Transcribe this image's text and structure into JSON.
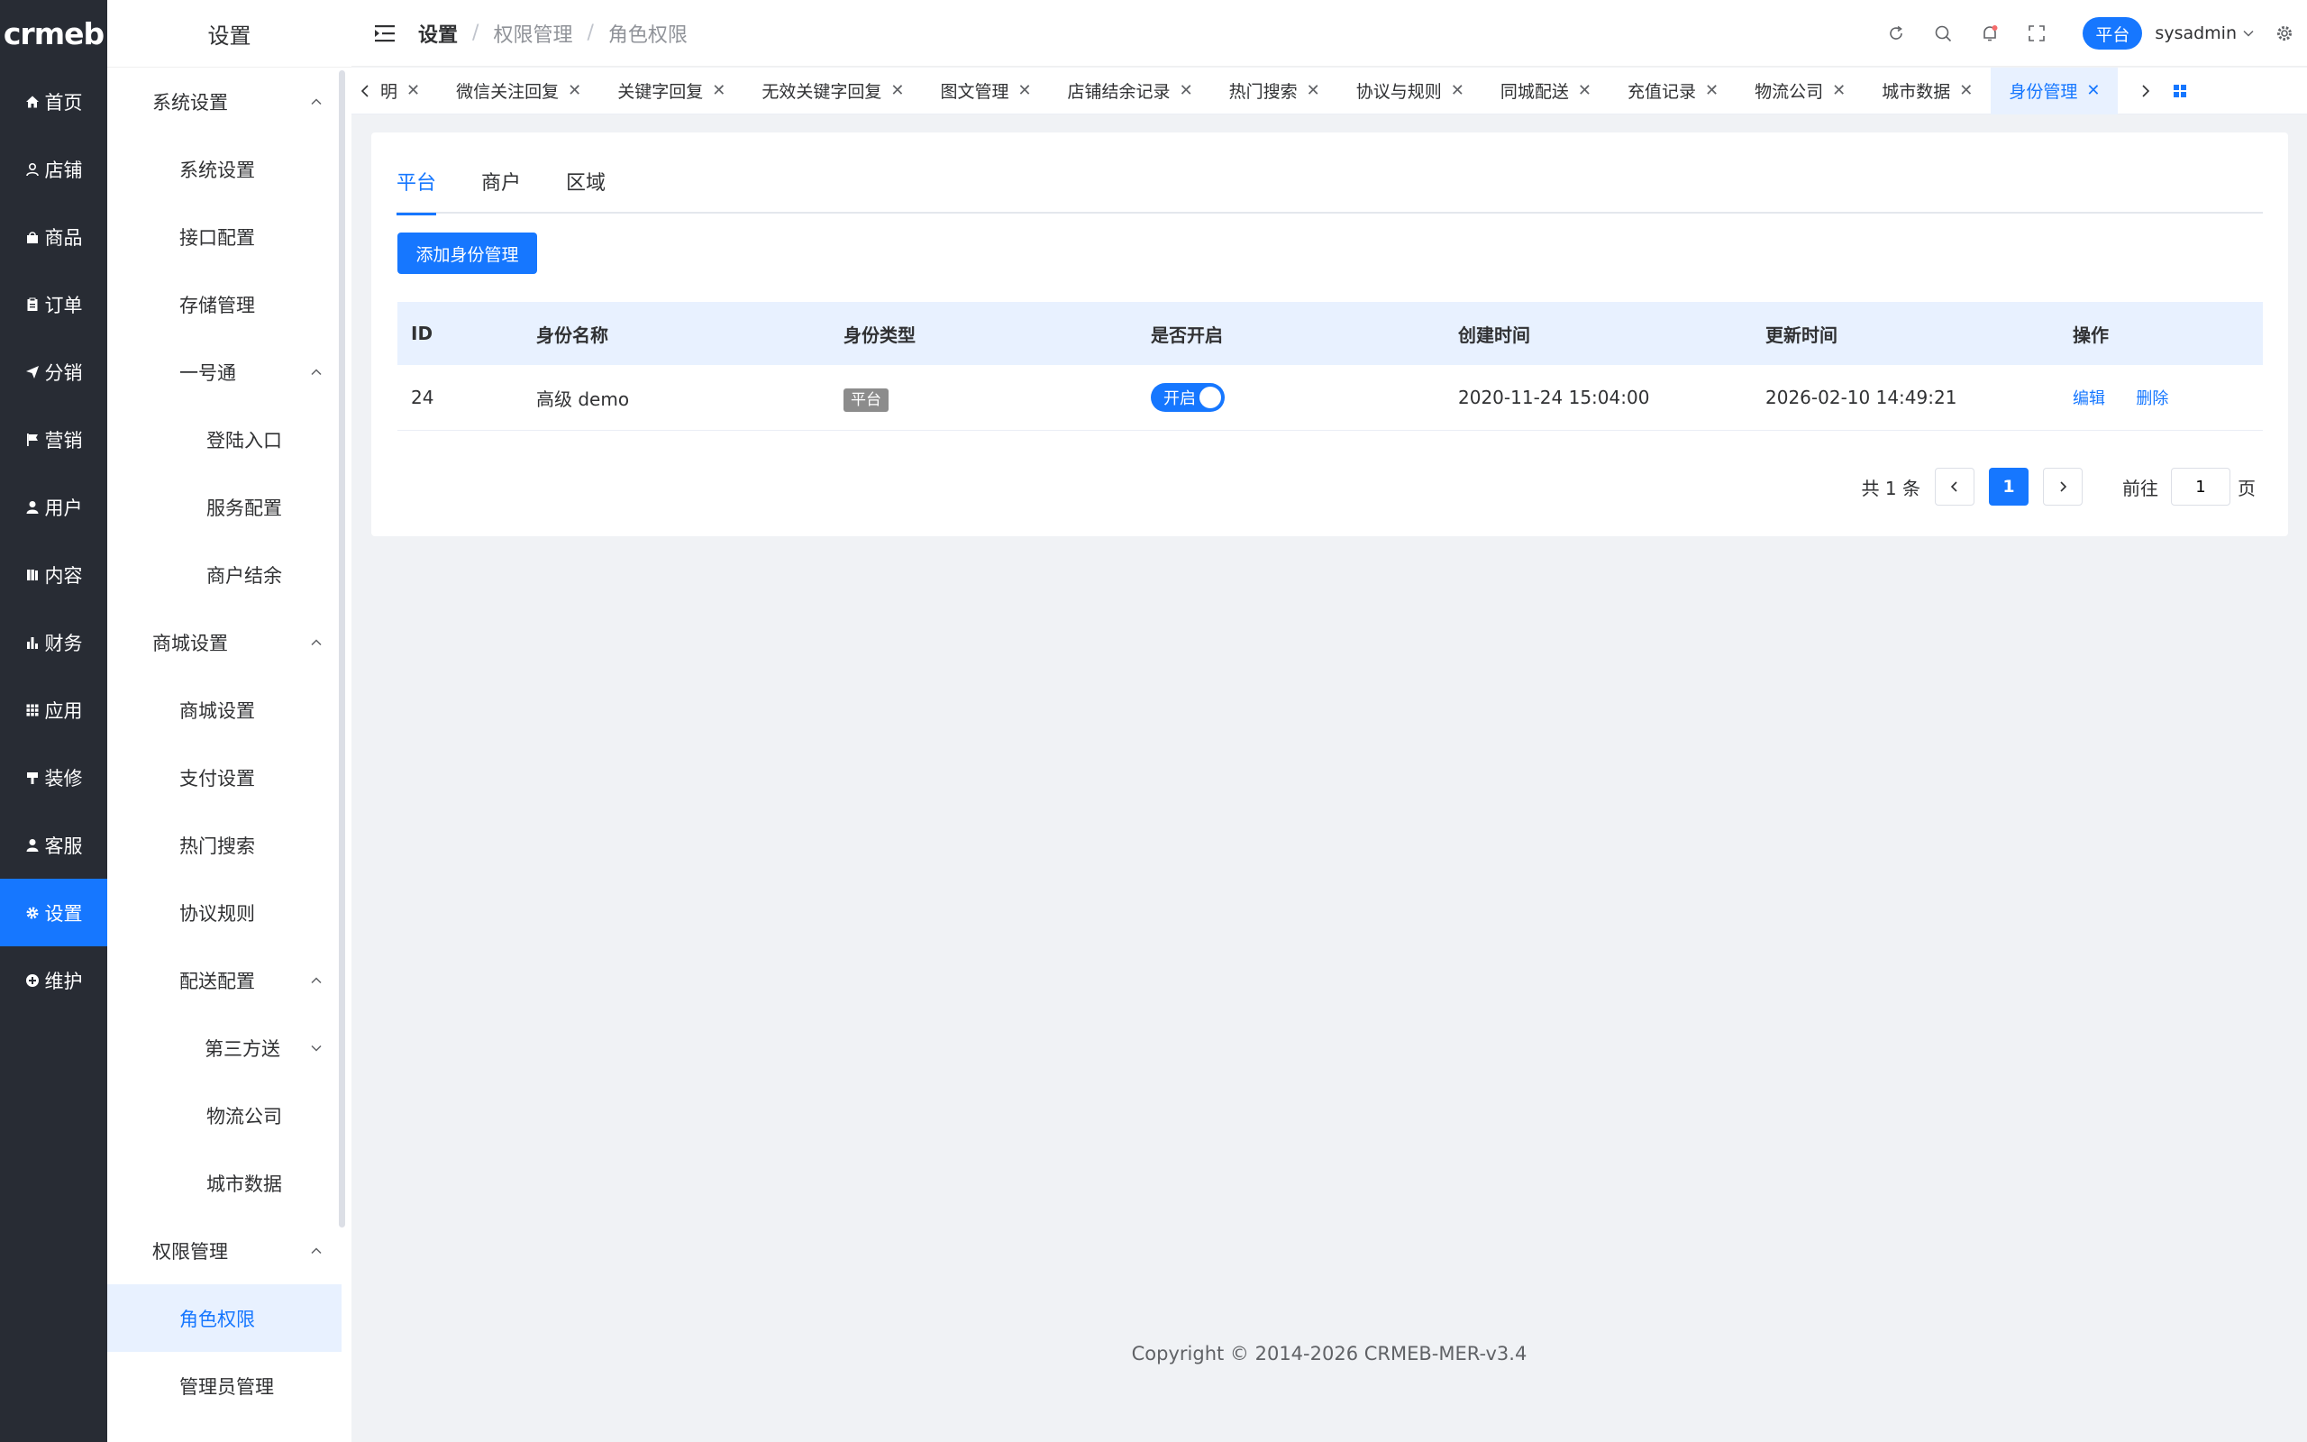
{
  "logo": "crmeb",
  "rail": [
    {
      "label": "首页",
      "icon": "home-icon"
    },
    {
      "label": "店铺",
      "icon": "store-icon"
    },
    {
      "label": "商品",
      "icon": "bag-icon"
    },
    {
      "label": "订单",
      "icon": "clipboard-icon"
    },
    {
      "label": "分销",
      "icon": "send-icon"
    },
    {
      "label": "营销",
      "icon": "flag-icon"
    },
    {
      "label": "用户",
      "icon": "user-icon"
    },
    {
      "label": "内容",
      "icon": "book-icon"
    },
    {
      "label": "财务",
      "icon": "bar-chart-icon"
    },
    {
      "label": "应用",
      "icon": "grid-icon"
    },
    {
      "label": "装修",
      "icon": "brush-icon"
    },
    {
      "label": "客服",
      "icon": "support-icon"
    },
    {
      "label": "设置",
      "icon": "gear-icon",
      "active": true
    },
    {
      "label": "维护",
      "icon": "plus-circle-icon"
    }
  ],
  "submenu": {
    "title": "设置",
    "items": [
      {
        "label": "系统设置",
        "level": 1,
        "arrow": "up"
      },
      {
        "label": "系统设置",
        "level": 2
      },
      {
        "label": "接口配置",
        "level": 2
      },
      {
        "label": "存储管理",
        "level": 2
      },
      {
        "label": "一号通",
        "level": 2,
        "arrow": "up"
      },
      {
        "label": "登陆入口",
        "level": 3
      },
      {
        "label": "服务配置",
        "level": 3
      },
      {
        "label": "商户结余",
        "level": 3
      },
      {
        "label": "商城设置",
        "level": 1,
        "arrow": "up"
      },
      {
        "label": "商城设置",
        "level": 2
      },
      {
        "label": "支付设置",
        "level": 2
      },
      {
        "label": "热门搜索",
        "level": 2
      },
      {
        "label": "协议规则",
        "level": 2
      },
      {
        "label": "配送配置",
        "level": 2,
        "arrow": "up"
      },
      {
        "label": "第三方送",
        "level": 3,
        "arrow": "down"
      },
      {
        "label": "物流公司",
        "level": 3
      },
      {
        "label": "城市数据",
        "level": 3
      },
      {
        "label": "权限管理",
        "level": 1,
        "arrow": "up"
      },
      {
        "label": "角色权限",
        "level": 2,
        "active": true
      },
      {
        "label": "管理员管理",
        "level": 2
      }
    ]
  },
  "header": {
    "breadcrumb": [
      "设置",
      "权限管理",
      "角色权限"
    ],
    "platform_badge": "平台",
    "username": "sysadmin"
  },
  "tags": [
    {
      "label": "明"
    },
    {
      "label": "微信关注回复"
    },
    {
      "label": "关键字回复"
    },
    {
      "label": "无效关键字回复"
    },
    {
      "label": "图文管理"
    },
    {
      "label": "店铺结余记录"
    },
    {
      "label": "热门搜索"
    },
    {
      "label": "协议与规则"
    },
    {
      "label": "同城配送"
    },
    {
      "label": "充值记录"
    },
    {
      "label": "物流公司"
    },
    {
      "label": "城市数据"
    },
    {
      "label": "身份管理",
      "active": true
    }
  ],
  "tabs": [
    "平台",
    "商户",
    "区域"
  ],
  "add_button": "添加身份管理",
  "table": {
    "columns": [
      "ID",
      "身份名称",
      "身份类型",
      "是否开启",
      "创建时间",
      "更新时间",
      "操作"
    ],
    "rows": [
      {
        "id": "24",
        "name": "高级 demo",
        "type": "平台",
        "switch": "开启",
        "created": "2020-11-24 15:04:00",
        "updated": "2026-02-10 14:49:21",
        "edit": "编辑",
        "delete": "删除"
      }
    ]
  },
  "pager": {
    "total": "共 1 条",
    "current": "1",
    "goto_label": "前往",
    "goto_value": "1",
    "page_label": "页"
  },
  "copyright": "Copyright © 2014-2026 CRMEB-MER-v3.4"
}
